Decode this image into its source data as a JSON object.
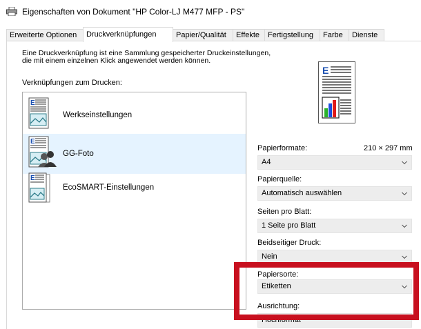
{
  "window": {
    "title": "Eigenschaften von Dokument \"HP Color-LJ M477 MFP - PS\""
  },
  "tabs": [
    {
      "label": "Erweiterte Optionen"
    },
    {
      "label": "Druckverknüpfungen"
    },
    {
      "label": "Papier/Qualität"
    },
    {
      "label": "Effekte"
    },
    {
      "label": "Fertigstellung"
    },
    {
      "label": "Farbe"
    },
    {
      "label": "Dienste"
    }
  ],
  "description": {
    "line1": "Eine Druckverknüpfung ist eine Sammlung gespeicherter Druckeinstellungen,",
    "line2": "die mit einem einzelnen Klick angewendet werden können."
  },
  "shortcuts": {
    "label": "Verknüpfungen zum Drucken:",
    "items": [
      {
        "label": "Werkseinstellungen",
        "icon": "document-landscape-icon"
      },
      {
        "label": "GG-Foto",
        "icon": "document-users-icon",
        "selected": true
      },
      {
        "label": "EcoSMART-Einstellungen",
        "icon": "document-pages-icon"
      }
    ]
  },
  "settings": {
    "paper_size": {
      "label": "Papierformate:",
      "dimension": "210 × 297 mm",
      "value": "A4"
    },
    "paper_source": {
      "label": "Papierquelle:",
      "value": "Automatisch auswählen"
    },
    "pages_per_sheet": {
      "label": "Seiten pro Blatt:",
      "value": "1 Seite pro Blatt"
    },
    "duplex": {
      "label": "Beidseitiger Druck:",
      "value": "Nein"
    },
    "paper_type": {
      "label": "Papiersorte:",
      "value": "Etiketten"
    },
    "orientation": {
      "label": "Ausrichtung:",
      "value": "Hochformat"
    }
  },
  "colors": {
    "highlight": "#c8101f",
    "selected_item": "#e5f3ff",
    "combo_bg": "#ededed"
  }
}
